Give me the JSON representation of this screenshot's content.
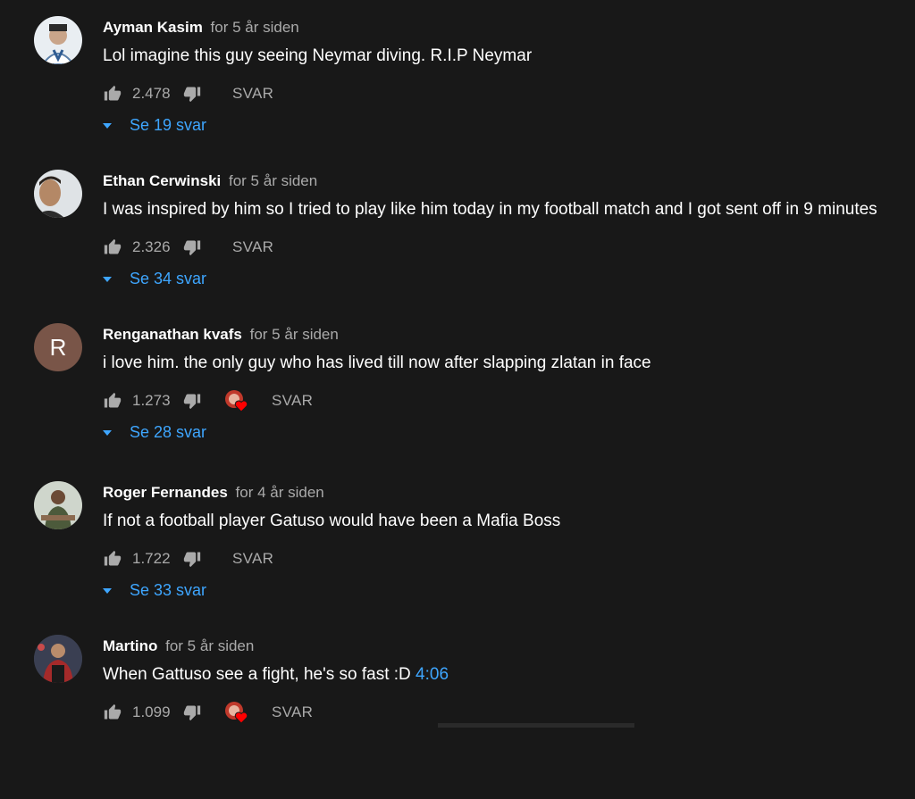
{
  "comments": [
    {
      "author": "Ayman Kasim",
      "time": "for 5 år siden",
      "text": "Lol imagine this guy seeing Neymar diving. R.I.P Neymar",
      "timestamp_link": "",
      "likes": "2.478",
      "reply_label": "SVAR",
      "replies_label": "Se 19 svar",
      "creator_heart": false,
      "avatar": "photo"
    },
    {
      "author": "Ethan Cerwinski",
      "time": "for 5 år siden",
      "text": "I was inspired by him so I tried to play like him today in my football match and I got sent off in 9 minutes",
      "timestamp_link": "",
      "likes": "2.326",
      "reply_label": "SVAR",
      "replies_label": "Se 34 svar",
      "creator_heart": false,
      "avatar": "photo"
    },
    {
      "author": "Renganathan kvafs",
      "time": "for 5 år siden",
      "text": "i love him. the only guy who has lived till now after slapping zlatan in face",
      "timestamp_link": "",
      "likes": "1.273",
      "reply_label": "SVAR",
      "replies_label": "Se 28 svar",
      "creator_heart": true,
      "avatar_letter": "R",
      "avatar": "letter"
    },
    {
      "author": "Roger Fernandes",
      "time": "for 4 år siden",
      "text": "If not a football player Gatuso would have been a Mafia Boss",
      "timestamp_link": "",
      "likes": "1.722",
      "reply_label": "SVAR",
      "replies_label": "Se 33 svar",
      "creator_heart": false,
      "avatar": "photo"
    },
    {
      "author": "Martino",
      "time": "for 5 år siden",
      "text": "When Gattuso see a fight, he's so fast :D",
      "timestamp_link": "4:06",
      "likes": "1.099",
      "reply_label": "SVAR",
      "replies_label": "",
      "creator_heart": true,
      "avatar": "photo"
    }
  ],
  "icons": {
    "like": "thumbs-up-icon",
    "dislike": "thumbs-down-icon",
    "heart": "creator-heart-icon",
    "toggle": "caret-down-icon"
  },
  "colors": {
    "background": "#181818",
    "link": "#3ea6ff",
    "secondary_text": "#aaaaaa",
    "heart": "#ff0000"
  }
}
